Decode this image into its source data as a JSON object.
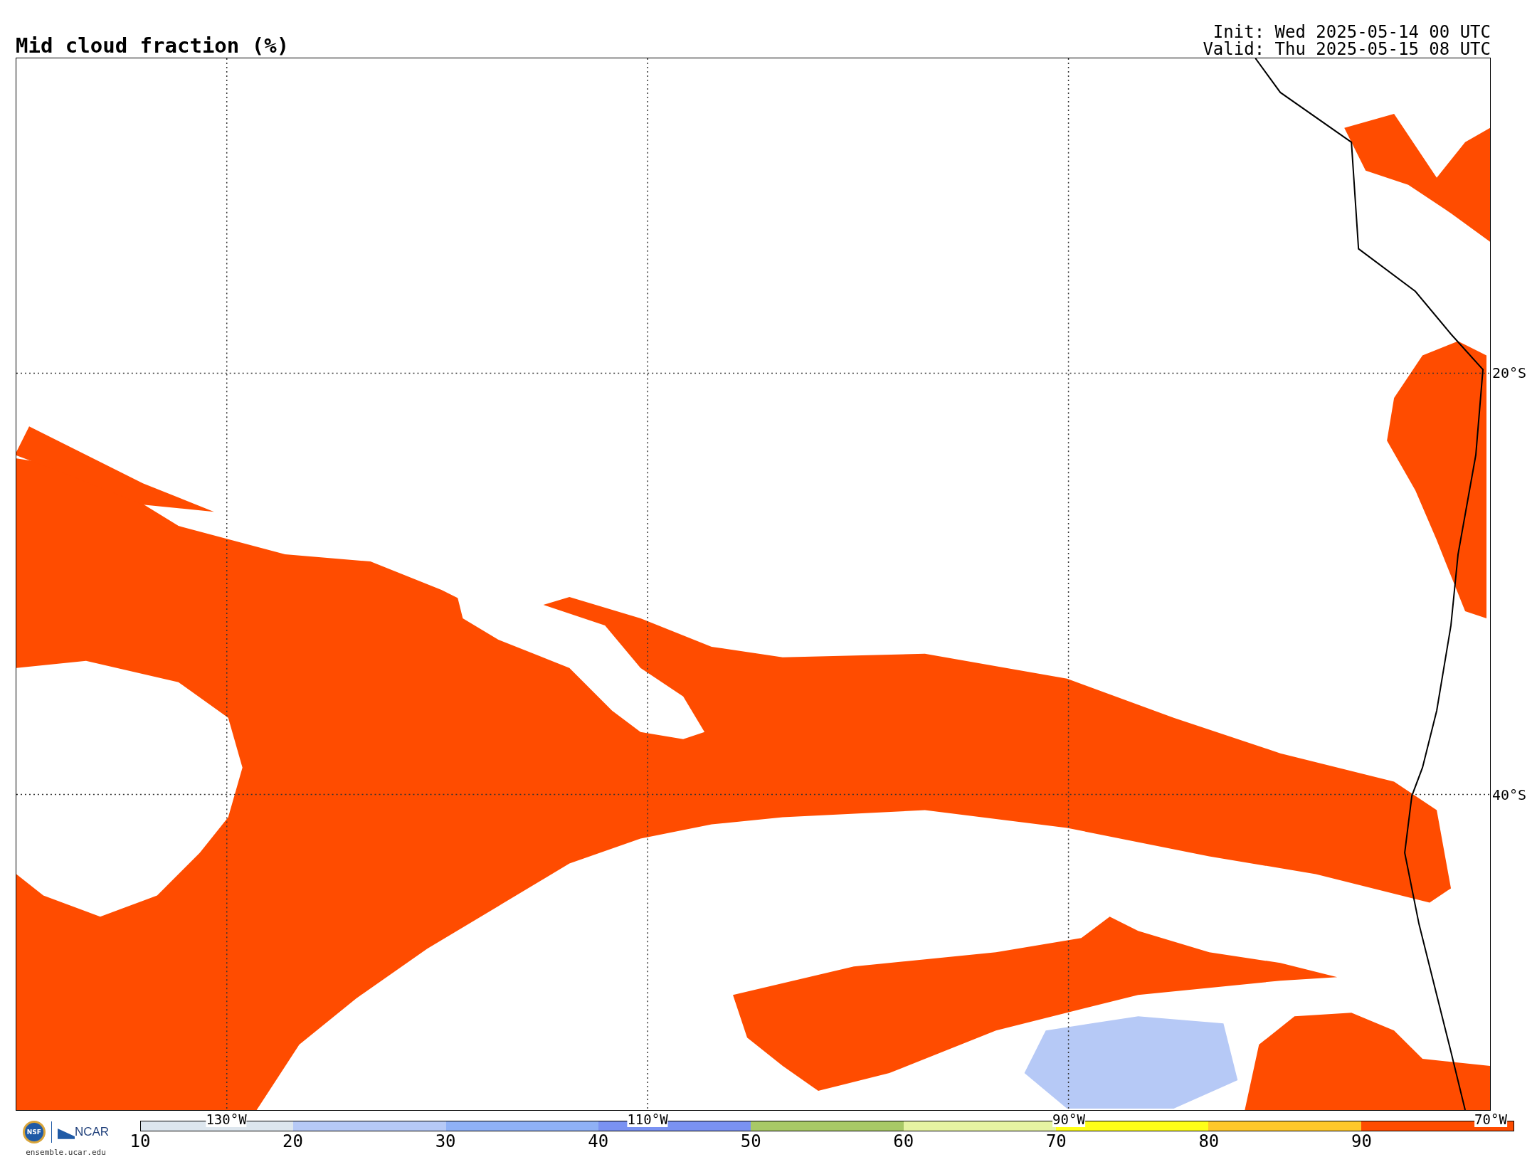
{
  "title": "Mid cloud fraction (%)",
  "run_info": [
    "Init: Wed 2025-05-14 00 UTC",
    "Valid: Thu 2025-05-15 08 UTC"
  ],
  "map": {
    "lon_labels": [
      "130°W",
      "110°W",
      "90°W",
      "70°W"
    ],
    "lat_labels": [
      "20°S",
      "40°S"
    ]
  },
  "logos": {
    "nsf": "NSF",
    "org": "NCAR",
    "site": "ensemble.ucar.edu"
  },
  "legend": {
    "bins": [
      {
        "color": "#dde6ee"
      },
      {
        "color": "#b6c9f6"
      },
      {
        "color": "#8fb1f6"
      },
      {
        "color": "#7a92f2"
      },
      {
        "color": "#a8c966"
      },
      {
        "color": "#e6f4a2"
      },
      {
        "color": "#ffff18"
      },
      {
        "color": "#ffc82a"
      },
      {
        "color": "#ff4c00"
      }
    ],
    "ticks": [
      "10",
      "20",
      "30",
      "40",
      "50",
      "60",
      "70",
      "80",
      "90"
    ]
  }
}
